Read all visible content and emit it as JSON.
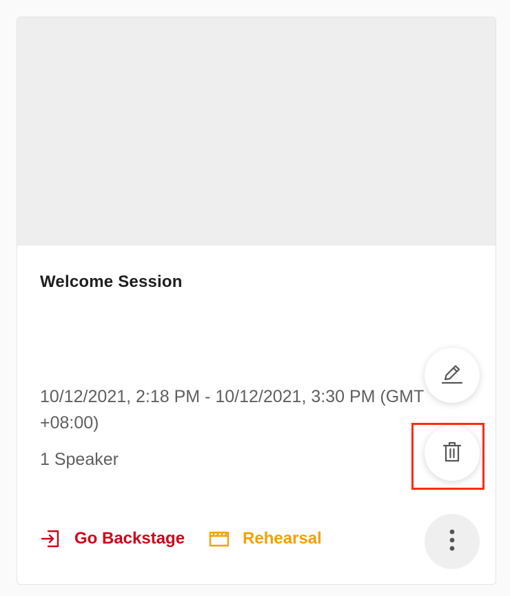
{
  "session": {
    "title": "Welcome Session",
    "time_line1": "10/12/2021, 2:18 PM - 10/12/2021, 3:30 PM (GMT",
    "time_line2": "+08:00)",
    "speakers": "1 Speaker"
  },
  "actions": {
    "backstage_label": "Go Backstage",
    "rehearsal_label": "Rehearsal"
  },
  "icons": {
    "edit": "pencil-icon",
    "delete": "trash-icon",
    "more": "more-vertical-icon",
    "backstage": "enter-icon",
    "rehearsal": "clapperboard-icon"
  },
  "colors": {
    "backstage": "#d0021b",
    "rehearsal": "#f5a000",
    "highlight": "#ff2a12"
  }
}
